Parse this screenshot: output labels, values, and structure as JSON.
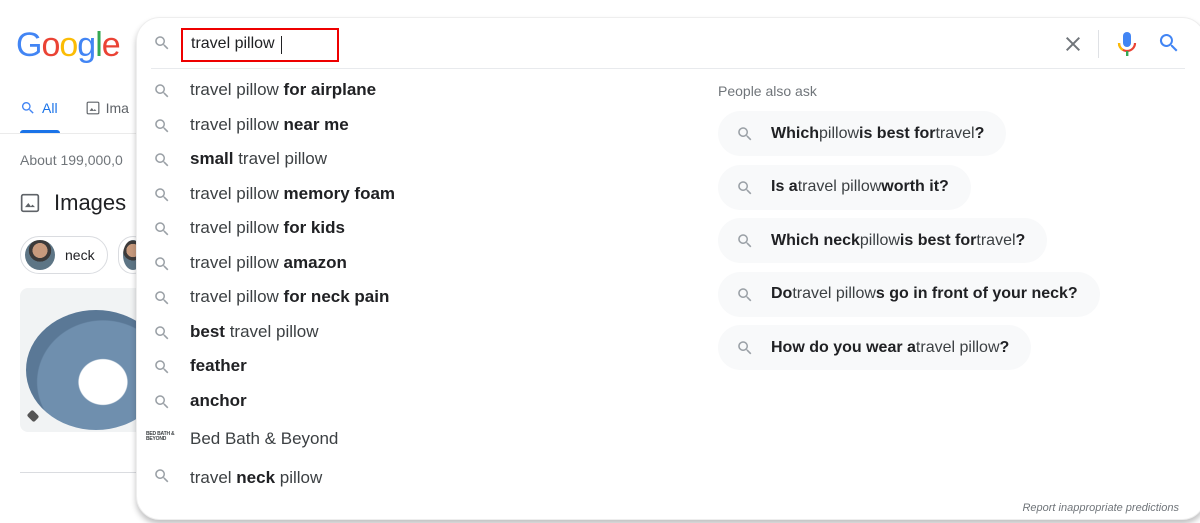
{
  "logo": {
    "letters": [
      {
        "char": "G",
        "color": "#4285f4"
      },
      {
        "char": "o",
        "color": "#ea4335"
      },
      {
        "char": "o",
        "color": "#fbbc05"
      },
      {
        "char": "g",
        "color": "#4285f4"
      },
      {
        "char": "l",
        "color": "#34a853"
      },
      {
        "char": "e",
        "color": "#ea4335"
      }
    ]
  },
  "tabs": [
    {
      "label": "All",
      "icon": "search-icon",
      "active": true
    },
    {
      "label": "Ima",
      "icon": "image-icon",
      "active": false
    }
  ],
  "result_stats": "About 199,000,0",
  "images_section": {
    "heading": "Images",
    "chips": [
      {
        "label": "neck"
      }
    ]
  },
  "search": {
    "query": "travel pillow",
    "clear_icon": "close-icon",
    "mic_icon": "microphone-icon",
    "search_icon": "search-icon"
  },
  "suggestions": [
    {
      "parts": [
        {
          "t": "travel pillow ",
          "b": false
        },
        {
          "t": "for airplane",
          "b": true
        }
      ]
    },
    {
      "parts": [
        {
          "t": "travel pillow ",
          "b": false
        },
        {
          "t": "near me",
          "b": true
        }
      ]
    },
    {
      "parts": [
        {
          "t": "small",
          "b": true
        },
        {
          "t": " travel pillow",
          "b": false
        }
      ]
    },
    {
      "parts": [
        {
          "t": "travel pillow ",
          "b": false
        },
        {
          "t": "memory foam",
          "b": true
        }
      ]
    },
    {
      "parts": [
        {
          "t": "travel pillow ",
          "b": false
        },
        {
          "t": "for kids",
          "b": true
        }
      ]
    },
    {
      "parts": [
        {
          "t": "travel pillow ",
          "b": false
        },
        {
          "t": "amazon",
          "b": true
        }
      ]
    },
    {
      "parts": [
        {
          "t": "travel pillow ",
          "b": false
        },
        {
          "t": "for neck pain",
          "b": true
        }
      ]
    },
    {
      "parts": [
        {
          "t": "best",
          "b": true
        },
        {
          "t": " travel pillow",
          "b": false
        }
      ]
    },
    {
      "parts": [
        {
          "t": "feather",
          "b": true
        }
      ]
    },
    {
      "parts": [
        {
          "t": "anchor",
          "b": true
        }
      ]
    }
  ],
  "brand_suggestion": {
    "label": "Bed Bath & Beyond",
    "logo_text": [
      "BED BATH &",
      "BEYOND"
    ]
  },
  "last_suggestion": {
    "parts": [
      {
        "t": "travel ",
        "b": false
      },
      {
        "t": "neck",
        "b": true
      },
      {
        "t": " pillow",
        "b": false
      }
    ]
  },
  "people_also_ask": {
    "title": "People also ask",
    "items": [
      {
        "parts": [
          {
            "t": "Which",
            "b": true
          },
          {
            "t": " pillow ",
            "b": false
          },
          {
            "t": "is best for",
            "b": true
          },
          {
            "t": " travel",
            "b": false
          },
          {
            "t": "?",
            "b": true
          }
        ]
      },
      {
        "parts": [
          {
            "t": "Is a",
            "b": true
          },
          {
            "t": " travel pillow ",
            "b": false
          },
          {
            "t": "worth it?",
            "b": true
          }
        ]
      },
      {
        "parts": [
          {
            "t": "Which neck",
            "b": true
          },
          {
            "t": " pillow ",
            "b": false
          },
          {
            "t": "is best for",
            "b": true
          },
          {
            "t": " travel",
            "b": false
          },
          {
            "t": "?",
            "b": true
          }
        ]
      },
      {
        "parts": [
          {
            "t": "Do",
            "b": true
          },
          {
            "t": " travel pillow",
            "b": false
          },
          {
            "t": "s go in front of your neck?",
            "b": true
          }
        ]
      },
      {
        "parts": [
          {
            "t": "How do you wear a",
            "b": true
          },
          {
            "t": " travel pillow",
            "b": false
          },
          {
            "t": "?",
            "b": true
          }
        ]
      }
    ]
  },
  "report_link": "Report inappropriate predictions",
  "colors": {
    "accent": "#1a73e8",
    "highlight_box": "#ee0000",
    "text_muted": "#70757a"
  }
}
